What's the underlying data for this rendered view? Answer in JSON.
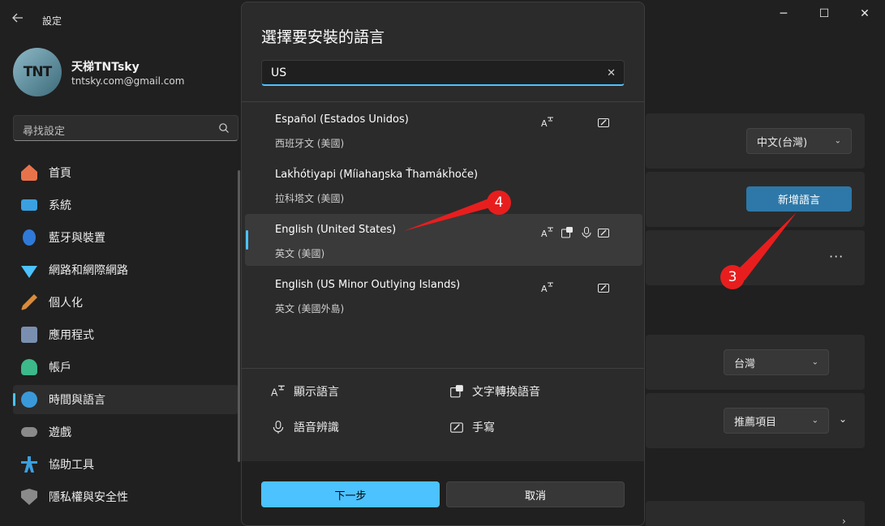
{
  "window": {
    "title": "設定",
    "controls": [
      "minimize",
      "maximize",
      "close"
    ]
  },
  "user": {
    "initials": "TNT",
    "name": "天梯TNTsky",
    "email": "tntsky.com@gmail.com"
  },
  "search": {
    "placeholder": "尋找設定"
  },
  "sidebar": {
    "items": [
      {
        "label": "首頁",
        "icon": "home-icon",
        "color": "#e8734a"
      },
      {
        "label": "系統",
        "icon": "system-icon",
        "color": "#3aa0e0"
      },
      {
        "label": "藍牙與裝置",
        "icon": "bluetooth-icon",
        "color": "#2f7ad8"
      },
      {
        "label": "網路和網際網路",
        "icon": "wifi-icon",
        "color": "#4cc2ff"
      },
      {
        "label": "個人化",
        "icon": "brush-icon",
        "color": "#d98b3a"
      },
      {
        "label": "應用程式",
        "icon": "apps-icon",
        "color": "#7a8fb0"
      },
      {
        "label": "帳戶",
        "icon": "account-icon",
        "color": "#3cb88a"
      },
      {
        "label": "時間與語言",
        "icon": "time-language-icon",
        "color": "#3a9ad9",
        "active": true
      },
      {
        "label": "遊戲",
        "icon": "gaming-icon",
        "color": "#8a8a8a"
      },
      {
        "label": "協助工具",
        "icon": "accessibility-icon",
        "color": "#3aa0e0"
      },
      {
        "label": "隱私權與安全性",
        "icon": "shield-icon",
        "color": "#8a8a8a"
      }
    ]
  },
  "main": {
    "display_language_value": "中文(台灣)",
    "add_language_label": "新增語言",
    "region_value": "台灣",
    "format_value": "推薦項目"
  },
  "dialog": {
    "title": "選擇要安裝的語言",
    "search_value": "US",
    "languages": [
      {
        "name": "Español (Estados Unidos)",
        "sub": "西班牙文 (美國)",
        "features": [
          "display",
          "handwriting"
        ]
      },
      {
        "name": "Lakȟótiyapi (Míiahaŋska Ťhamákȟoče)",
        "sub": "拉科塔文 (美國)",
        "features": []
      },
      {
        "name": "English (United States)",
        "sub": "英文 (美國)",
        "features": [
          "display",
          "tts",
          "speech",
          "handwriting"
        ],
        "selected": true
      },
      {
        "name": "English (US Minor Outlying Islands)",
        "sub": "英文 (美國外島)",
        "features": [
          "display",
          "handwriting"
        ]
      }
    ],
    "legend": {
      "display": "顯示語言",
      "tts": "文字轉換語音",
      "speech": "語音辨識",
      "handwriting": "手寫"
    },
    "next_label": "下一步",
    "cancel_label": "取消"
  },
  "annotations": {
    "step3": "3",
    "step4": "4",
    "color": "#e81e1e"
  },
  "colors": {
    "accent": "#4cc2ff",
    "background": "#202020",
    "dialog": "#2b2b2b"
  }
}
